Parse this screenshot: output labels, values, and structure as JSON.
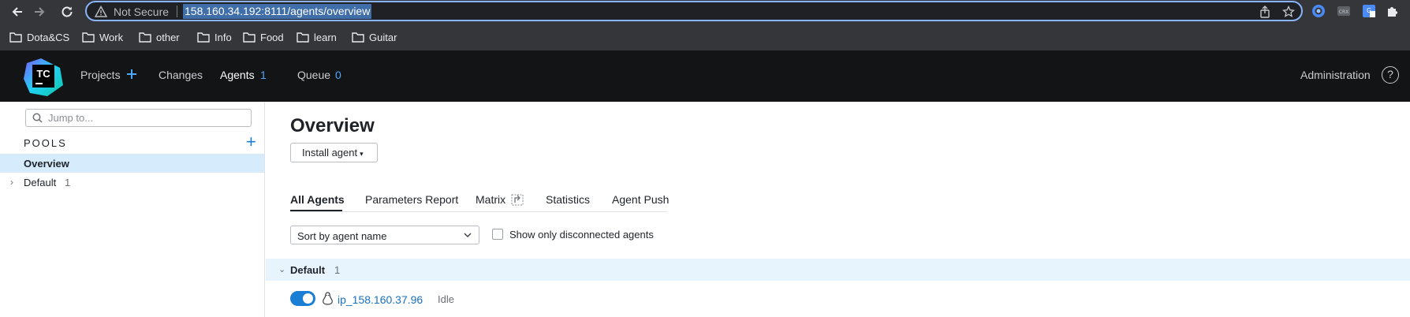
{
  "browser": {
    "security_label": "Not Secure",
    "url": "158.160.34.192:8111/agents/overview",
    "bookmarks": [
      "Dota&CS",
      "Work",
      "other",
      "Info",
      "Food",
      "learn",
      "Guitar"
    ],
    "extension_icons": [
      "chrome-remote-icon",
      "crx-extension-icon",
      "google-translate-icon",
      "puzzle-extensions-icon"
    ],
    "accent_color": "#8ab4f8"
  },
  "header": {
    "logo_text": "TC",
    "nav": {
      "projects": "Projects",
      "changes": "Changes",
      "agents": "Agents",
      "agents_count": "1",
      "queue": "Queue",
      "queue_count": "0"
    },
    "administration": "Administration",
    "help_symbol": "?",
    "background_color": "#131416",
    "count_color": "#4aa8ff"
  },
  "sidebar": {
    "search_placeholder": "Jump to...",
    "pools_title": "POOLS",
    "add_symbol": "+",
    "items": [
      {
        "label": "Overview",
        "selected": true
      },
      {
        "label": "Default",
        "count": "1",
        "expandable": true
      }
    ],
    "selected_color": "#d6ebfb"
  },
  "main": {
    "title": "Overview",
    "install_agent": "Install agent",
    "tabs": [
      "All Agents",
      "Parameters Report",
      "Matrix",
      "Statistics",
      "Agent Push"
    ],
    "active_tab": "All Agents",
    "sort_select": {
      "value": "Sort by agent name"
    },
    "show_disconnected": {
      "label": "Show only disconnected agents",
      "checked": false
    },
    "group": {
      "name": "Default",
      "count": "1",
      "expanded": true
    },
    "agents": [
      {
        "name": "ip_158.160.37.96",
        "status": "Idle",
        "enabled": true,
        "os": "linux-icon"
      }
    ],
    "accent_color": "#1a7fd4"
  }
}
